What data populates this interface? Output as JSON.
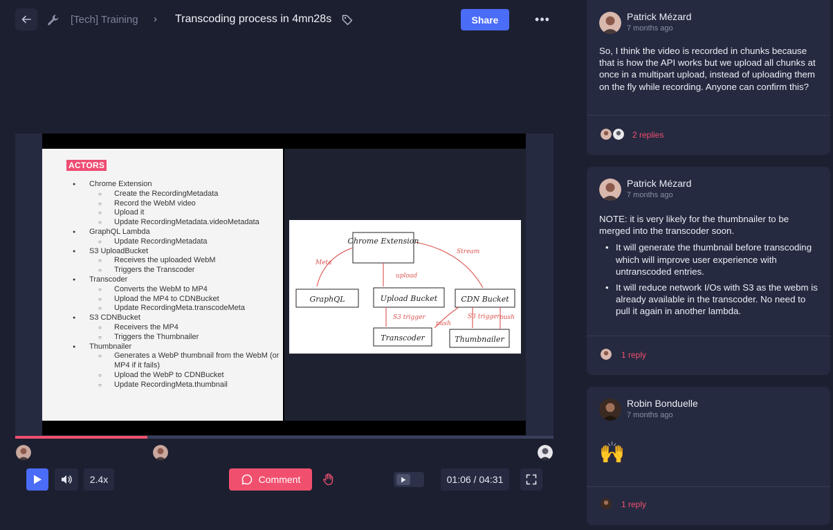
{
  "header": {
    "breadcrumb_parent": "[Tech] Training",
    "breadcrumb_separator": "›",
    "title": "Transcoding process in 4mn28s",
    "share_label": "Share",
    "more_label": "•••"
  },
  "slide": {
    "heading": "ACTORS",
    "outline": [
      {
        "level": 1,
        "text": "Chrome Extension"
      },
      {
        "level": 2,
        "text": "Create the RecordingMetadata"
      },
      {
        "level": 2,
        "text": "Record the WebM video"
      },
      {
        "level": 2,
        "text": "Upload it"
      },
      {
        "level": 2,
        "text": "Update RecordingMetadata.videoMetadata"
      },
      {
        "level": 1,
        "text": "GraphQL Lambda"
      },
      {
        "level": 2,
        "text": "Update RecordingMetadata"
      },
      {
        "level": 1,
        "text": "S3 UploadBucket"
      },
      {
        "level": 2,
        "text": "Receives the uploaded WebM"
      },
      {
        "level": 2,
        "text": "Triggers the Transcoder"
      },
      {
        "level": 1,
        "text": "Transcoder"
      },
      {
        "level": 2,
        "text": "Converts the WebM to MP4"
      },
      {
        "level": 2,
        "text": "Upload the MP4 to CDNBucket"
      },
      {
        "level": 2,
        "text": "Update RecordingMeta.transcodeMeta"
      },
      {
        "level": 1,
        "text": "S3 CDNBucket"
      },
      {
        "level": 2,
        "text": "Receivers the MP4"
      },
      {
        "level": 2,
        "text": "Triggers the Thumbnailer"
      },
      {
        "level": 1,
        "text": "Thumbnailer"
      },
      {
        "level": 2,
        "text": "Generates a WebP thumbnail from the WebM (or MP4 if it fails)"
      },
      {
        "level": 2,
        "text": "Upload the WebP to CDNBucket"
      },
      {
        "level": 2,
        "text": "Update RecordingMeta.thumbnail"
      }
    ],
    "diagram": {
      "chrome": "Chrome Extension",
      "graphql": "GraphQL",
      "upload_bucket": "Upload Bucket",
      "cdn_bucket": "CDN Bucket",
      "transcoder": "Transcoder",
      "thumbnailer": "Thumbnailer",
      "meta": "Meta",
      "upload": "upload",
      "stream": "Stream",
      "s3_trigger": "S3 trigger",
      "push": "push",
      "s3_trigger_2": "S3 trigger",
      "push_2": "push"
    }
  },
  "player": {
    "progress_fraction": 0.246,
    "speed": "2.4x",
    "comment_label": "Comment",
    "time": "01:06 / 04:31"
  },
  "comments": [
    {
      "author": "Patrick Mézard",
      "time": "7 months ago",
      "body": "So, I think the video is recorded in chunks because that is how the API works but we upload all chunks at once in a multipart upload, instead of uploading them on the fly while recording. Anyone can confirm this?",
      "replies": "2 replies"
    },
    {
      "author": "Patrick Mézard",
      "time": "7 months ago",
      "body": "NOTE: it is very likely for the thumbnailer to be merged into the transcoder soon.",
      "bullets": [
        "It will generate the thumbnail before transcoding which will improve user experience with untranscoded entries.",
        "It will reduce network I/Os with S3 as the webm is already available in the transcoder. No need to pull it again in another lambda."
      ],
      "replies": "1 reply"
    },
    {
      "author": "Robin Bonduelle",
      "time": "7 months ago",
      "body": "🙌",
      "replies": "1 reply"
    }
  ],
  "colors": {
    "accent_blue": "#4a6cf7",
    "accent_pink": "#f0506e",
    "background": "#1c1f30",
    "card": "#262a40"
  }
}
